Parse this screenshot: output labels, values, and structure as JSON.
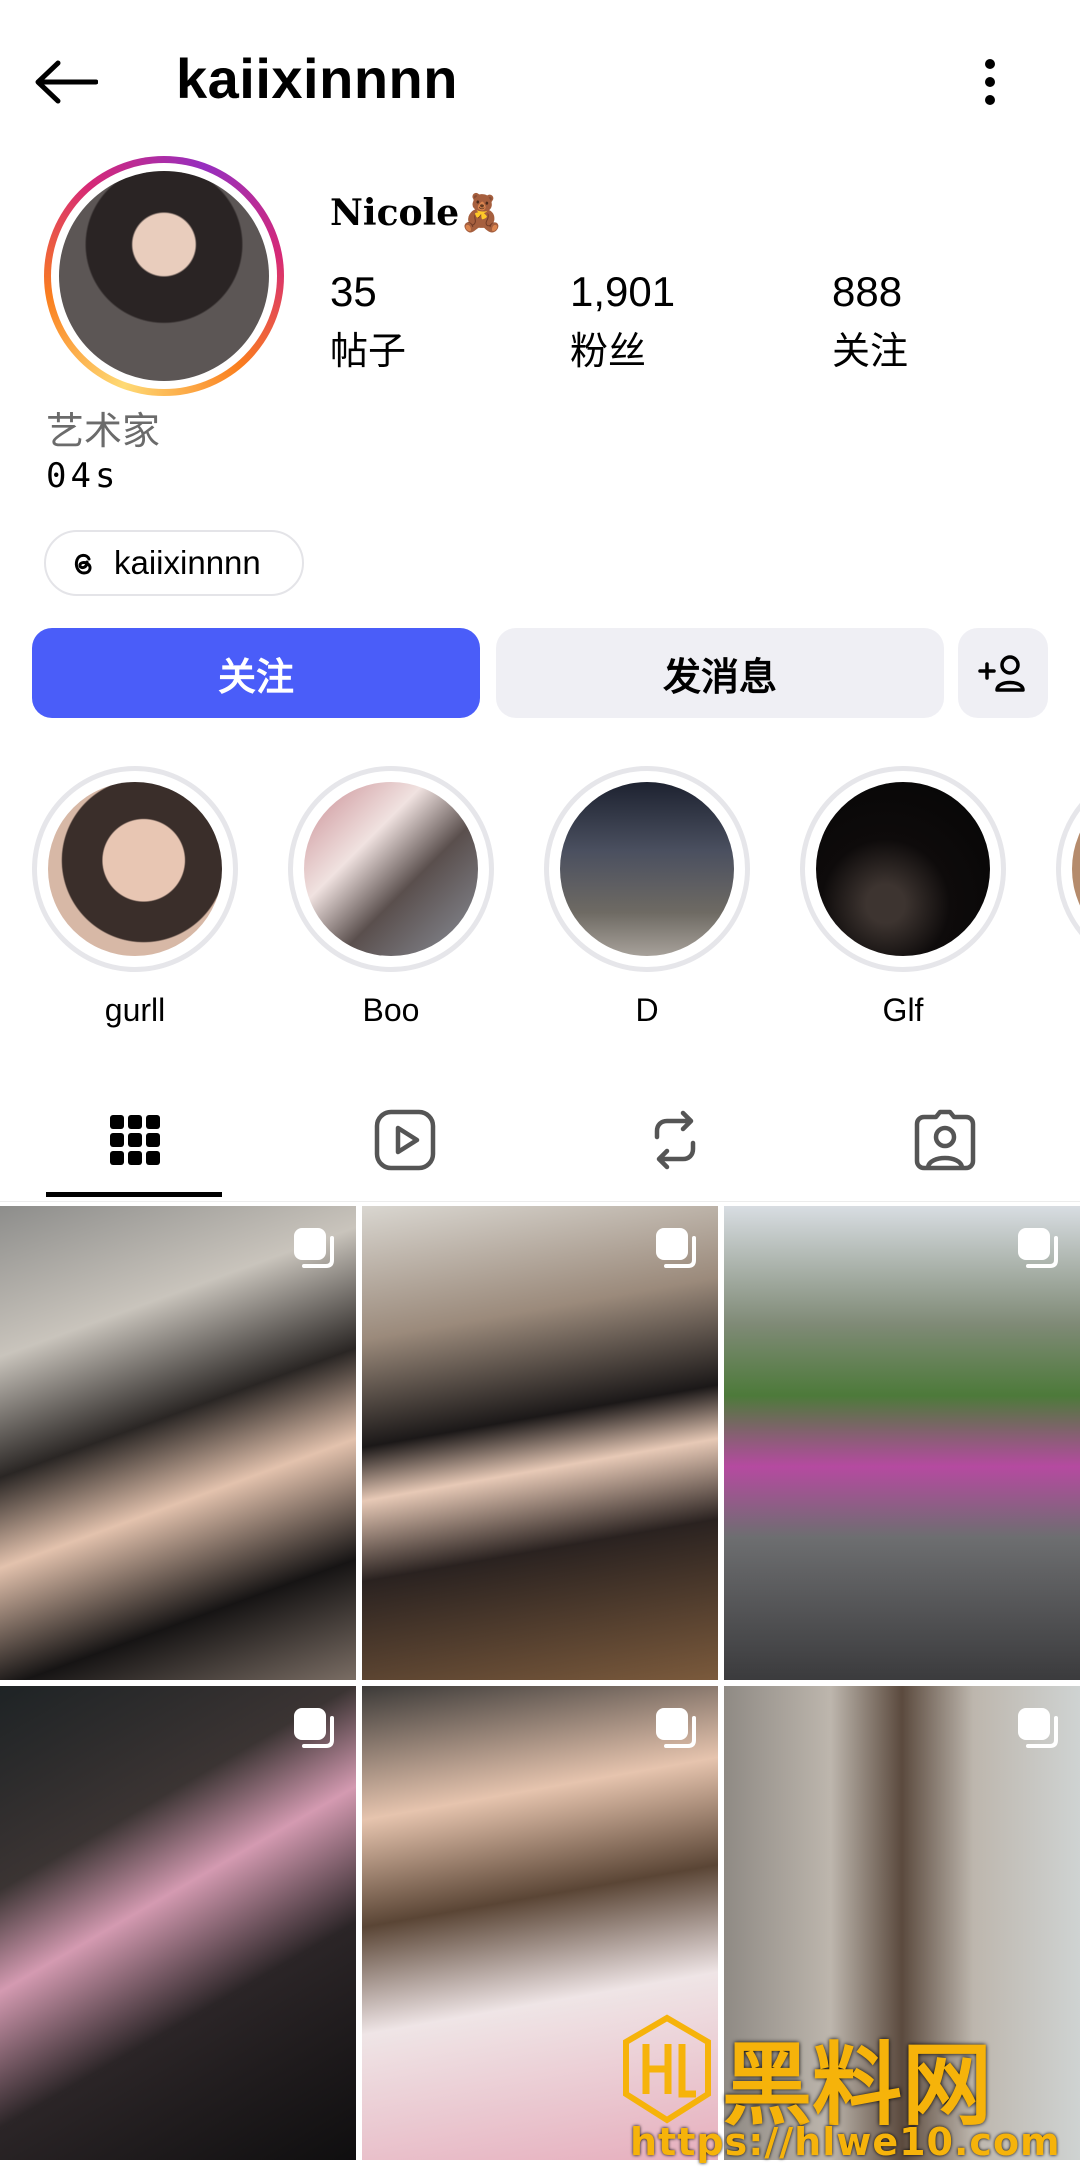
{
  "header": {
    "username": "kaiixinnnn",
    "back_icon": "arrow-left-icon",
    "more_icon": "more-vertical-icon"
  },
  "profile": {
    "display_name": "Nicole🧸",
    "category": "艺术家",
    "bio": "04s",
    "threads_handle": "kaiixinnnn",
    "stats": [
      {
        "value": "35",
        "label": "帖子"
      },
      {
        "value": "1,901",
        "label": "粉丝"
      },
      {
        "value": "888",
        "label": "关注"
      }
    ]
  },
  "actions": {
    "follow_label": "关注",
    "message_label": "发消息",
    "suggest_icon": "add-person-icon"
  },
  "highlights": [
    {
      "label": "gurll"
    },
    {
      "label": "Boo"
    },
    {
      "label": "D"
    },
    {
      "label": "Glf"
    }
  ],
  "tabs": [
    {
      "icon": "grid-icon",
      "active": true
    },
    {
      "icon": "reels-icon",
      "active": false
    },
    {
      "icon": "reposts-icon",
      "active": false
    },
    {
      "icon": "tagged-icon",
      "active": false
    }
  ],
  "posts_count_shown": 6,
  "watermark": {
    "text": "黑料网",
    "url": "https://hlwe10.com"
  },
  "colors": {
    "accent": "#4a5df9",
    "secondary_button": "#efeff4",
    "watermark": "#f6b30a"
  }
}
